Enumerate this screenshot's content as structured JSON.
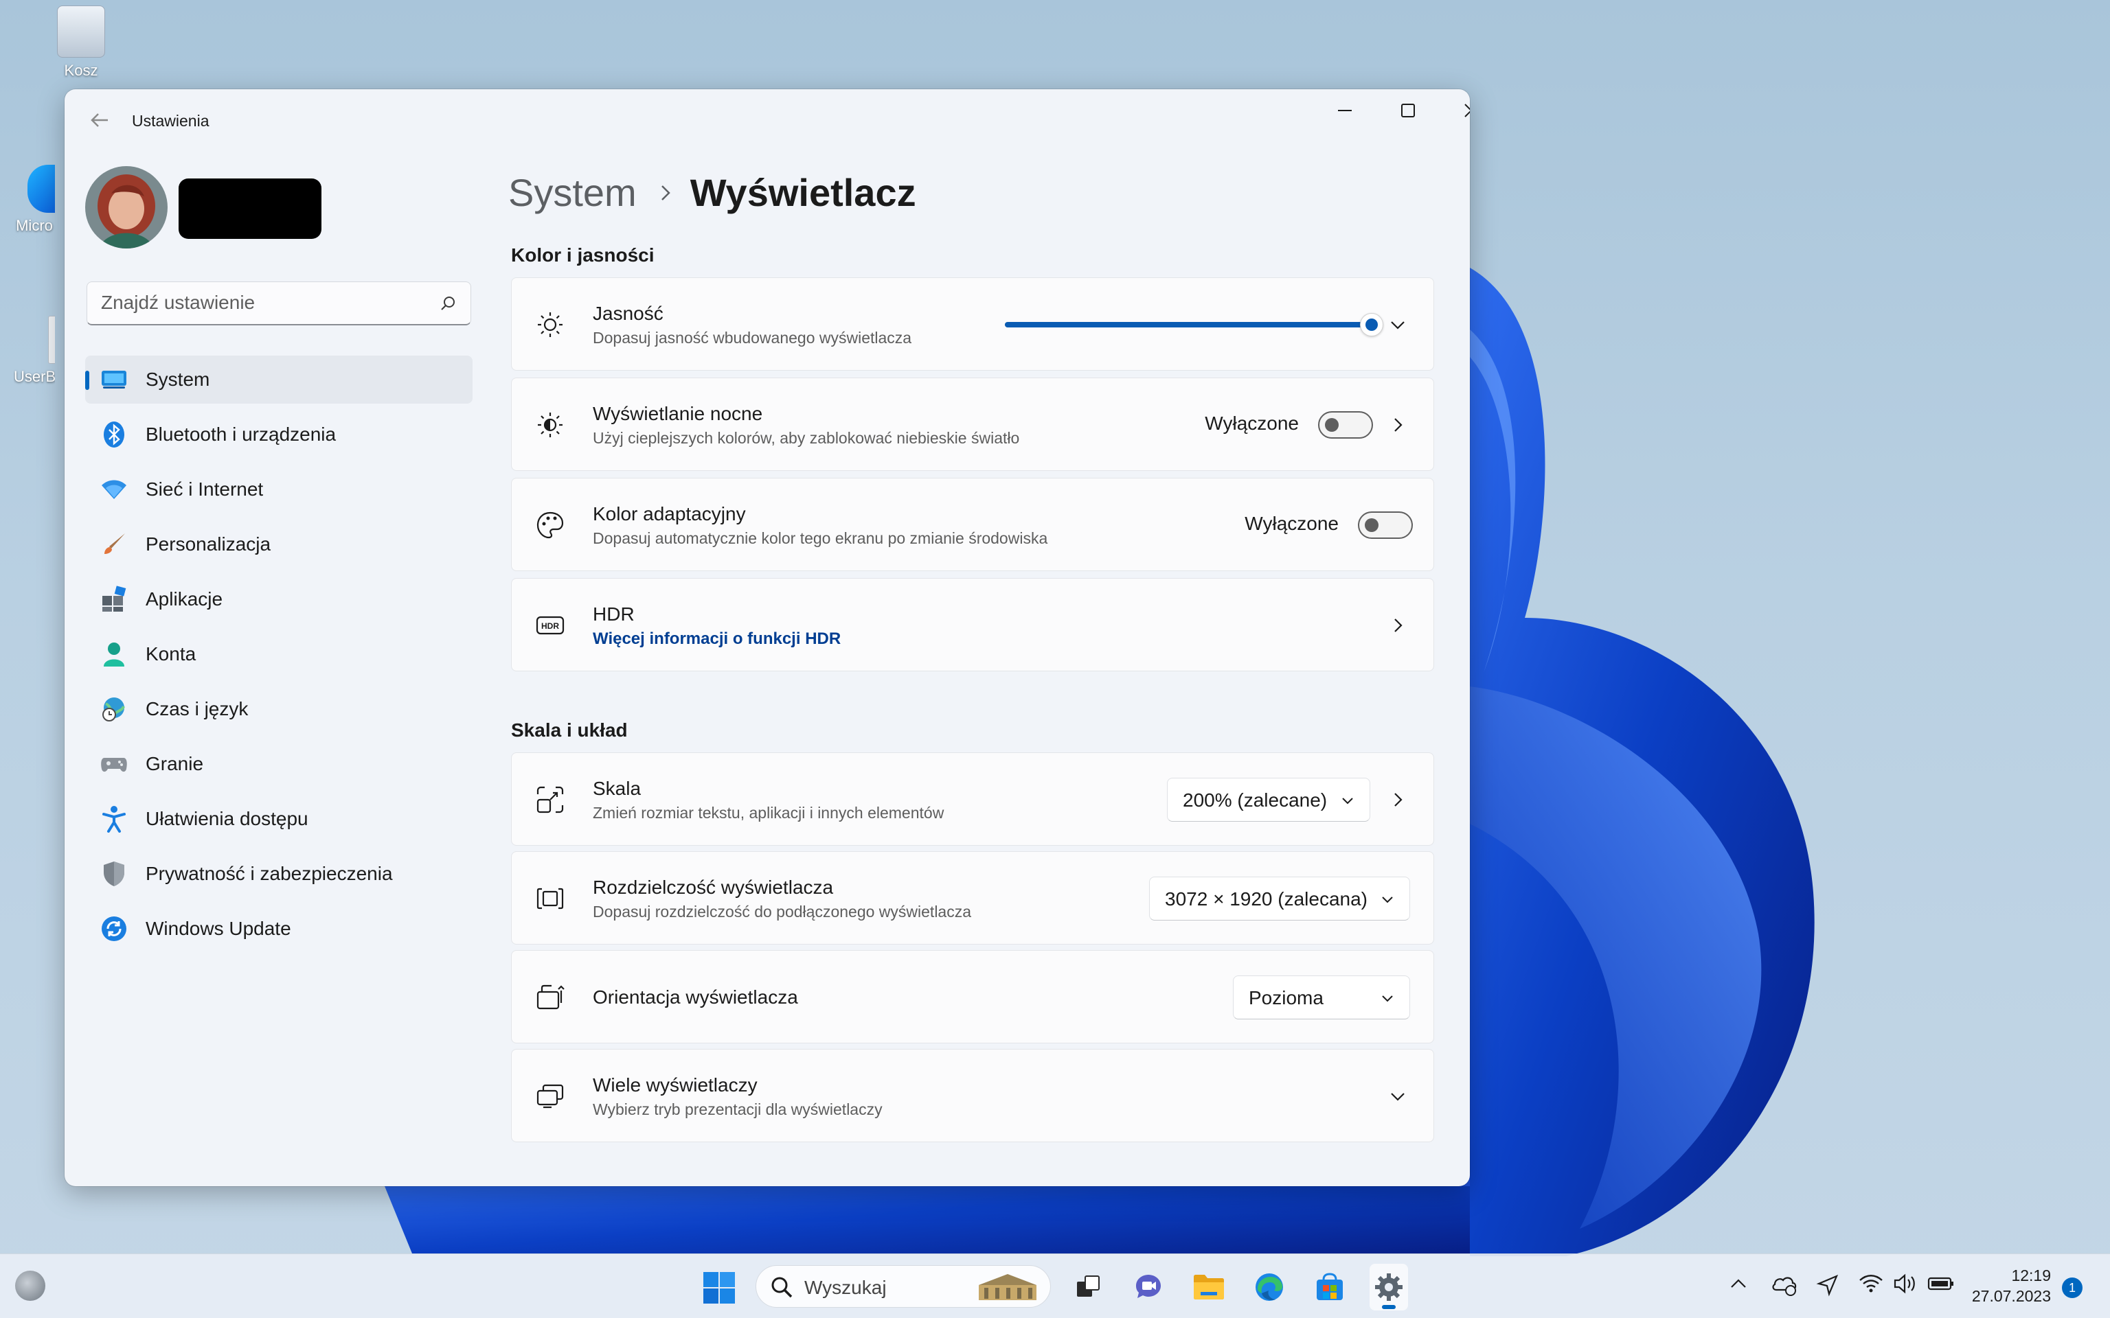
{
  "desktop": {
    "icons": [
      {
        "label": "Kosz"
      },
      {
        "label": "Micro"
      },
      {
        "label": "UserB"
      }
    ]
  },
  "window": {
    "title": "Ustawienia",
    "search_placeholder": "Znajdź ustawienie",
    "nav": [
      {
        "label": "System",
        "icon": "system-icon",
        "active": true
      },
      {
        "label": "Bluetooth i urządzenia",
        "icon": "bluetooth-icon"
      },
      {
        "label": "Sieć i Internet",
        "icon": "wifi-icon"
      },
      {
        "label": "Personalizacja",
        "icon": "brush-icon"
      },
      {
        "label": "Aplikacje",
        "icon": "apps-icon"
      },
      {
        "label": "Konta",
        "icon": "account-icon"
      },
      {
        "label": "Czas i język",
        "icon": "globe-clock-icon"
      },
      {
        "label": "Granie",
        "icon": "gamepad-icon"
      },
      {
        "label": "Ułatwienia dostępu",
        "icon": "accessibility-icon"
      },
      {
        "label": "Prywatność i zabezpieczenia",
        "icon": "shield-icon"
      },
      {
        "label": "Windows Update",
        "icon": "update-icon"
      }
    ],
    "breadcrumb": {
      "parent": "System",
      "current": "Wyświetlacz"
    },
    "sections": {
      "color": {
        "title": "Kolor i jasności",
        "brightness": {
          "title": "Jasność",
          "subtitle": "Dopasuj jasność wbudowanego wyświetlacza",
          "value": 1.0
        },
        "night_light": {
          "title": "Wyświetlanie nocne",
          "subtitle": "Użyj cieplejszych kolorów, aby zablokować niebieskie światło",
          "state": "Wyłączone"
        },
        "adaptive_color": {
          "title": "Kolor adaptacyjny",
          "subtitle": "Dopasuj automatycznie kolor tego ekranu po zmianie środowiska",
          "state": "Wyłączone"
        },
        "hdr": {
          "title": "HDR",
          "link": "Więcej informacji o funkcji HDR"
        }
      },
      "scale": {
        "title": "Skala i układ",
        "scale": {
          "title": "Skala",
          "subtitle": "Zmień rozmiar tekstu, aplikacji i innych elementów",
          "value": "200% (zalecane)"
        },
        "resolution": {
          "title": "Rozdzielczość wyświetlacza",
          "subtitle": "Dopasuj rozdzielczość do podłączonego wyświetlacza",
          "value": "3072 × 1920 (zalecana)"
        },
        "orientation": {
          "title": "Orientacja wyświetlacza",
          "value": "Pozioma"
        },
        "multiple": {
          "title": "Wiele wyświetlaczy",
          "subtitle": "Wybierz tryb prezentacji dla wyświetlaczy"
        }
      }
    }
  },
  "taskbar": {
    "search_label": "Wyszukaj",
    "time": "12:19",
    "date": "27.07.2023",
    "notification_count": "1"
  },
  "colors": {
    "accent": "#0067c0",
    "slider": "#0a5cb3",
    "link": "#003e92"
  }
}
